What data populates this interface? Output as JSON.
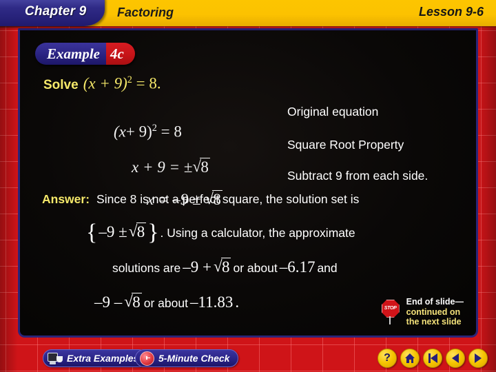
{
  "header": {
    "chapter": "Chapter 9",
    "topic": "Factoring",
    "lesson": "Lesson 9-6"
  },
  "example": {
    "word": "Example",
    "number": "4c"
  },
  "problem": {
    "solve_label": "Solve",
    "solve_equation": "(x + 9)² = 8."
  },
  "steps": [
    {
      "equation": "(x + 9)² = 8",
      "annotation": "Original equation"
    },
    {
      "equation": "x + 9 = ±√8",
      "annotation": "Square Root Property"
    },
    {
      "equation": "x = –9 ± √8",
      "annotation": "Subtract 9 from each side."
    }
  ],
  "equation_parts": {
    "eq1_lead": "(x",
    "eq1_plus": "+ 9)",
    "eq1_sup": "2",
    "eq1_tail": "= 8",
    "eq2_lead": "x + 9 = ±",
    "eq2_radicand": "8",
    "eq3_lead": "x = –9 ±",
    "eq3_radicand": "8",
    "solve_lead": "(x + 9)",
    "solve_sup": "2",
    "solve_tail": "= 8."
  },
  "answer": {
    "label": "Answer:",
    "line1": "Since 8 is not a perfect square, the solution set is",
    "brace_open": "{",
    "brace_inner_lead": "–9 ±",
    "brace_radicand": "8",
    "brace_close": "}",
    "line2_after_brace": ".  Using a calculator, the approximate",
    "line3_lead": "solutions are",
    "line3_expr_lead": "–9 +",
    "line3_radicand": "8",
    "line3_mid": "or about",
    "line3_value": "–6.17",
    "line3_end": "and",
    "line4_expr_lead": "–9 –",
    "line4_radicand": "8",
    "line4_mid": "or about",
    "line4_value": "–11.83",
    "line4_end": "."
  },
  "end_of_slide": {
    "stop_label": "STOP",
    "line1": "End of slide—",
    "line2": "continued on",
    "line3": "the next slide"
  },
  "toolbar": {
    "extra_examples": "Extra Examples",
    "five_minute_check": "5-Minute Check",
    "help": "?",
    "home_icon": "home-icon",
    "first_icon": "skip-back-icon",
    "prev_icon": "previous-icon",
    "next_icon": "next-icon"
  },
  "colors": {
    "header_yellow": "#fcc200",
    "chapter_navy": "#2a2386",
    "example_red": "#c41317",
    "frame_red": "#cf1418",
    "accent_yellow_text": "#f6e96a",
    "panel_black": "#0a0807"
  }
}
